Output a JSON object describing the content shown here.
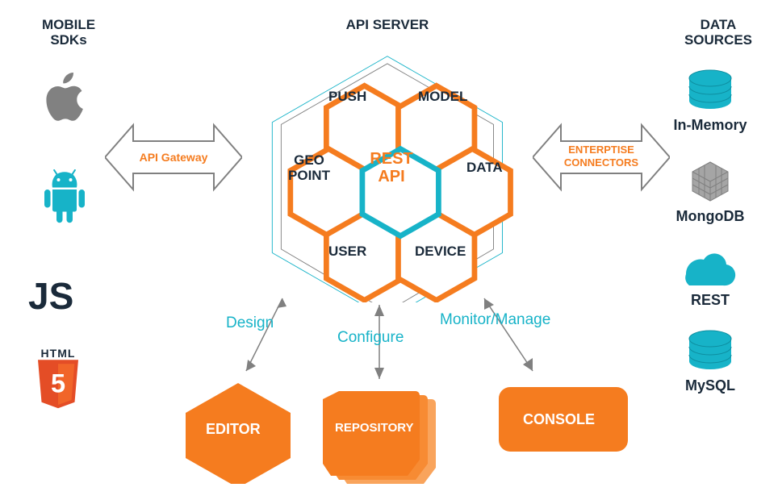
{
  "headers": {
    "left": "MOBILE SDKs",
    "center": "API SERVER",
    "right": "DATA SOURCES"
  },
  "sdks": {
    "js": "JS",
    "html5_top": "HTML",
    "html5_num": "5"
  },
  "arrows": {
    "left": "API Gateway",
    "right": "ENTERPTISE CONNECTORS"
  },
  "hex": {
    "center": "REST API",
    "push": "PUSH",
    "model": "MODEL",
    "geo": "GEO POINT",
    "data": "DATA",
    "user": "USER",
    "device": "DEVICE"
  },
  "flows": {
    "design": "Design",
    "configure": "Configure",
    "monitor": "Monitor/Manage"
  },
  "bottom": {
    "editor": "EDITOR",
    "repository": "REPOSITORY",
    "console": "CONSOLE"
  },
  "datasources": {
    "inmemory": "In-Memory",
    "mongodb": "MongoDB",
    "rest": "REST",
    "mysql": "MySQL"
  }
}
